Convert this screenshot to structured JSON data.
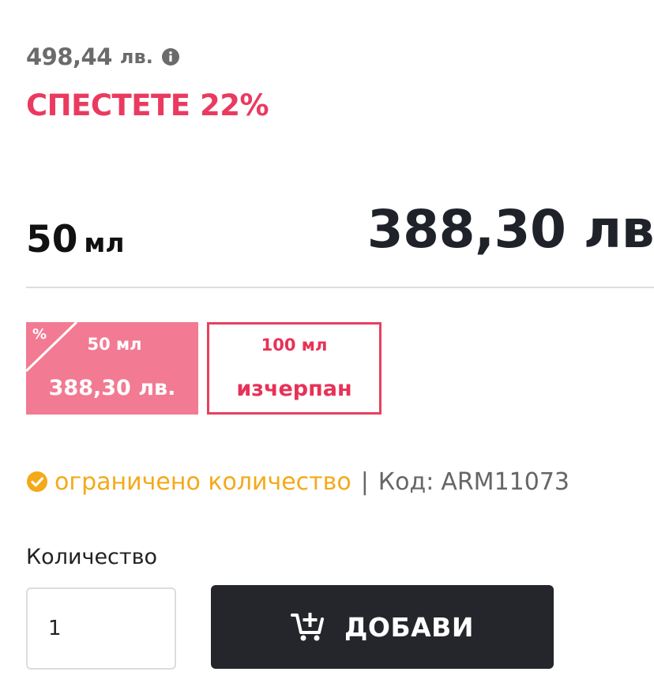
{
  "pricing": {
    "old_price": "498,44",
    "old_price_currency": "лв.",
    "savings_text": "СПЕСТЕТЕ 22%",
    "selected_size_number": "50",
    "selected_size_unit": "мл",
    "current_price": "388,30 лв"
  },
  "variants": [
    {
      "size": "50 мл",
      "value": "388,30 лв.",
      "discount_badge": "%",
      "selected": true
    },
    {
      "size": "100 мл",
      "value": "изчерпан",
      "selected": false
    }
  ],
  "availability": {
    "status": "ограничено количество",
    "separator": "|",
    "code_label": "Код:",
    "code_value": "ARM11073"
  },
  "purchase": {
    "quantity_label": "Количество",
    "quantity_value": "1",
    "add_button_label": "ДОБАВИ"
  },
  "icons": {
    "old_price_info": "info-icon",
    "availability": "check-circle-icon",
    "add_button": "cart-plus-icon"
  },
  "colors": {
    "accent_red": "#ea3a60",
    "selected_variant_bg": "#f27a93",
    "availability_orange": "#f4a91a",
    "button_dark": "#25262b"
  }
}
